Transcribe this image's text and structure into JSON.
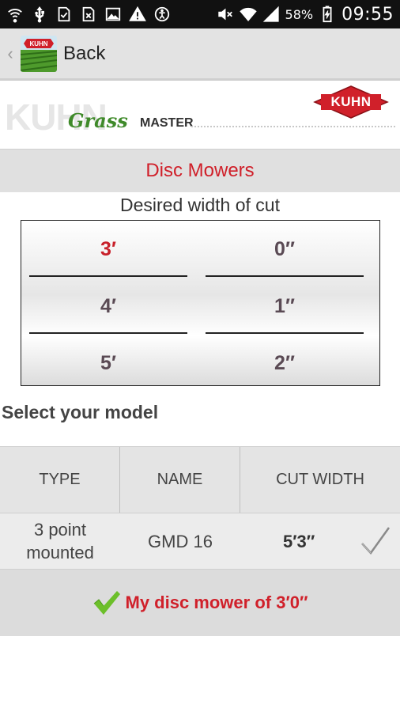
{
  "status_bar": {
    "battery": "58%",
    "time": "09:55",
    "left_icons": [
      "wifi-icon",
      "usb-icon",
      "download-done-icon",
      "sim-error-icon",
      "image-icon",
      "warning-icon",
      "accessibility-icon"
    ],
    "right_icons": [
      "mute-icon",
      "wifi-signal-icon",
      "cell-signal-icon",
      "battery-charging-icon"
    ]
  },
  "action_bar": {
    "back_label": "Back"
  },
  "banner": {
    "brand_bg_text": "KUHN",
    "grass_text": "Grass",
    "master_text": "MASTER",
    "logo_text": "KUHN"
  },
  "section_title": "Disc Mowers",
  "subtitle": "Desired width of cut",
  "picker": {
    "feet": [
      "3′",
      "4′",
      "5′"
    ],
    "inches": [
      "0″",
      "1″",
      "2″"
    ],
    "selected_feet": "3′",
    "selected_inches": "0″"
  },
  "select_model_label": "Select your model",
  "table": {
    "headers": [
      "TYPE",
      "NAME",
      "CUT WIDTH"
    ],
    "rows": [
      {
        "type_line1": "3 point",
        "type_line2": "mounted",
        "name": "GMD 16",
        "cut_width": "5′3″"
      }
    ]
  },
  "confirm_label": "My disc mower of 3′0″",
  "colors": {
    "accent_red": "#d0202a",
    "check_green": "#6cbf2a",
    "brand_green": "#3f8a2a"
  }
}
